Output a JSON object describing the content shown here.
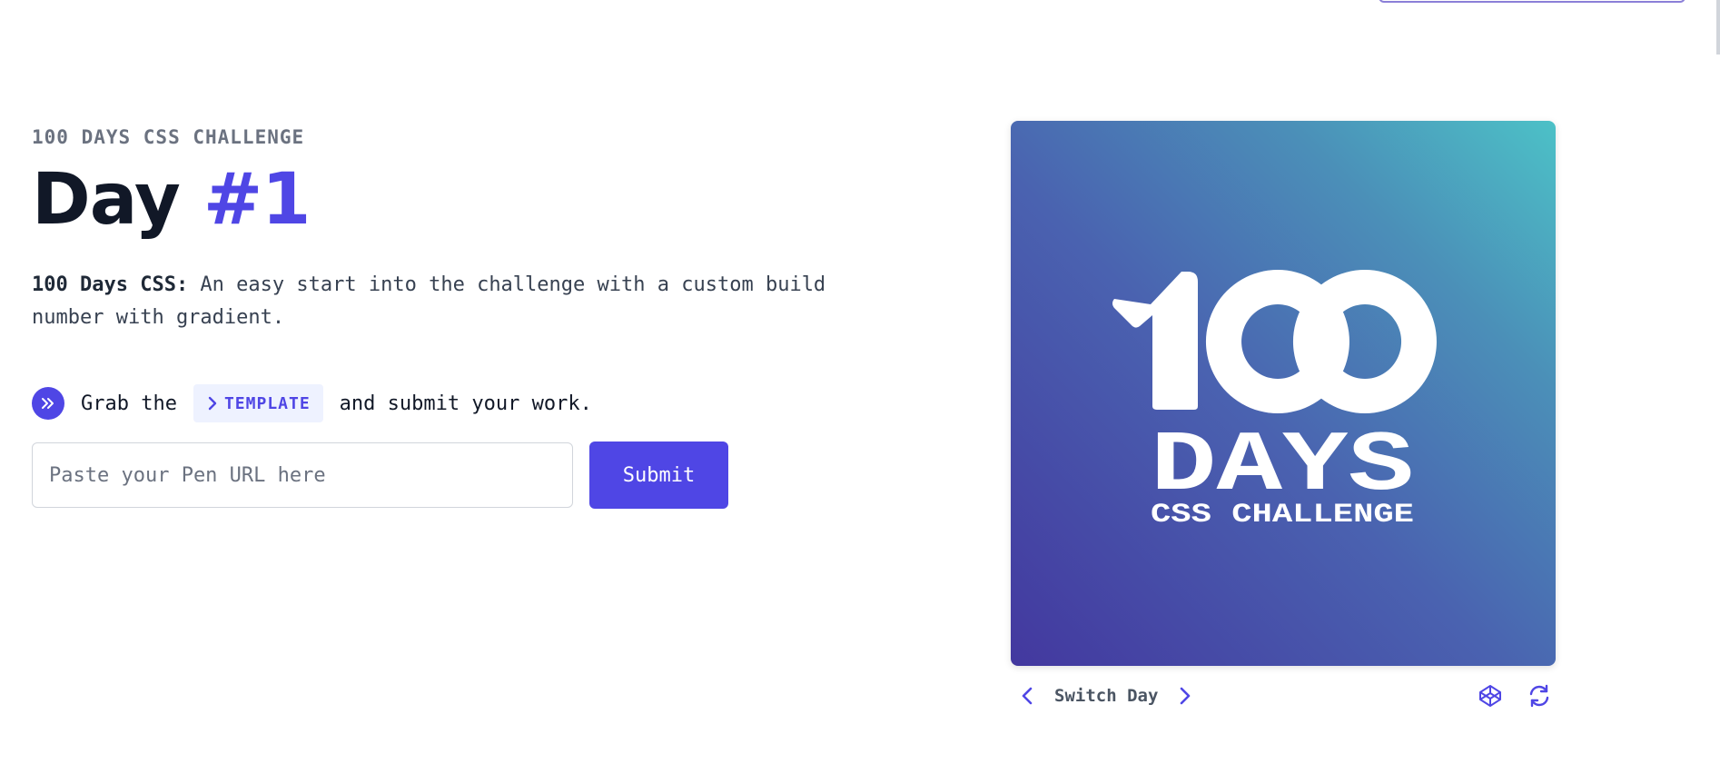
{
  "header": {
    "eyebrow": "100 DAYS CSS CHALLENGE",
    "title_word": "Day",
    "title_number": "#1"
  },
  "description": {
    "bold": "100 Days CSS:",
    "text": " An easy start into the challenge with a custom build number with gradient."
  },
  "grab": {
    "prefix": "Grab the",
    "template_label": "TEMPLATE",
    "suffix": "and submit your work."
  },
  "form": {
    "placeholder": "Paste your Pen URL here",
    "value": "",
    "submit_label": "Submit"
  },
  "preview": {
    "logo_number": "100",
    "logo_days": "DAYS",
    "logo_subtitle": "CSS CHALLENGE"
  },
  "controls": {
    "switch_label": "Switch Day"
  },
  "icons": {
    "grab": "double-chevron-right-icon",
    "template": "chevron-right-icon",
    "prev": "chevron-left-icon",
    "next": "chevron-right-icon",
    "codepen": "codepen-icon",
    "refresh": "refresh-icon"
  },
  "colors": {
    "accent": "#4f46e5",
    "gradient_start": "#43389f",
    "gradient_end": "#4cc1c7",
    "text_muted": "#6b7280"
  }
}
